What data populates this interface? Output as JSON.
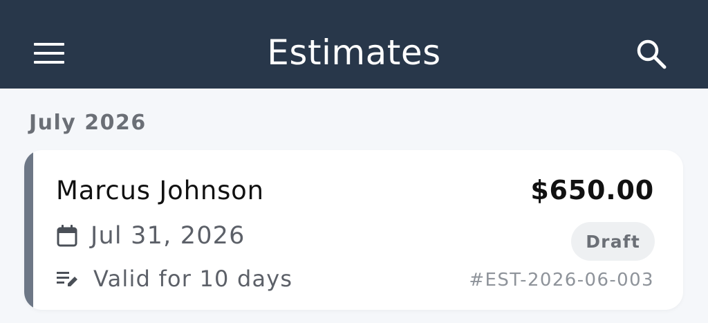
{
  "app_bar": {
    "title": "Estimates",
    "menu_icon": "hamburger-menu-icon",
    "search_icon": "search-icon",
    "background_color": "#28374a"
  },
  "section": {
    "header": "July 2026"
  },
  "estimates": [
    {
      "client_name": "Marcus Johnson",
      "amount": "$650.00",
      "date": "Jul 31, 2026",
      "date_icon": "calendar-icon",
      "validity": "Valid for 10 days",
      "validity_icon": "edit-note-icon",
      "status": "Draft",
      "number": "#EST-2026-06-003",
      "accent_color": "#6d7786"
    }
  ]
}
